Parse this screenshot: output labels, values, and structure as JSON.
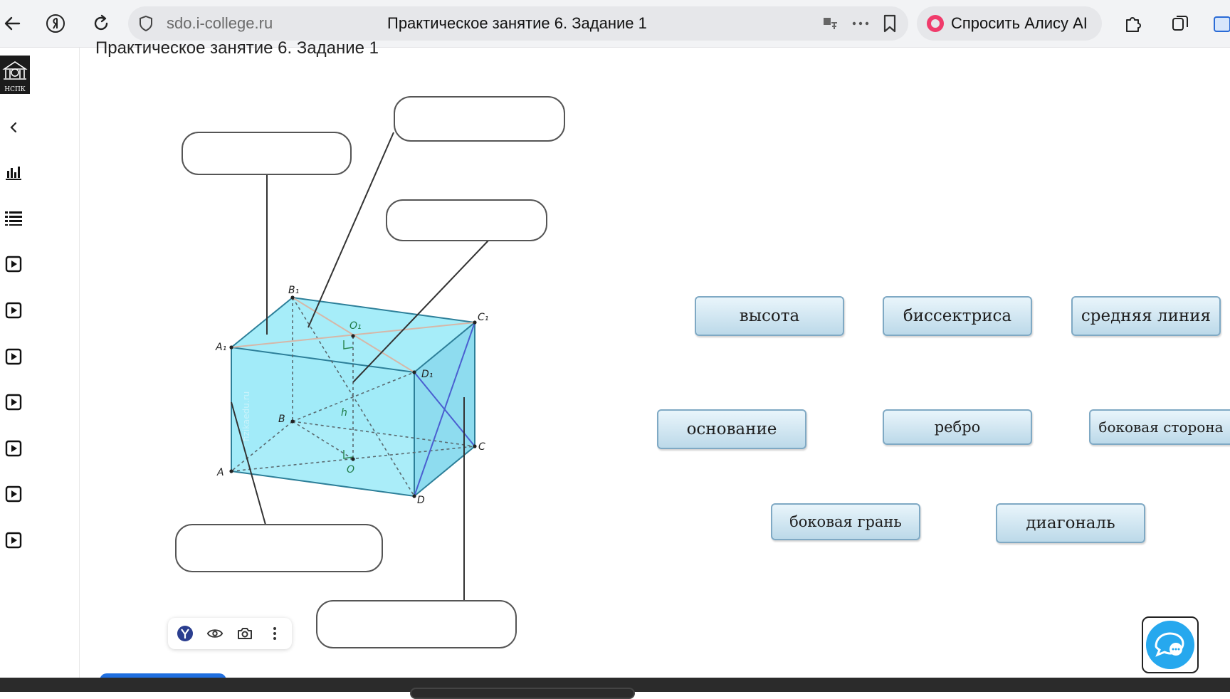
{
  "browser": {
    "url": "sdo.i-college.ru",
    "tab_title": "Практическое занятие 6. Задание 1",
    "alice_label": "Спросить Алису AI"
  },
  "sidebar": {
    "logo_text": "НСПК"
  },
  "page": {
    "heading": "Практическое занятие 6. Задание 1"
  },
  "diagram": {
    "vertex_labels": [
      "B₁",
      "C₁",
      "A₁",
      "D₁",
      "O₁",
      "B",
      "C",
      "A",
      "D",
      "O",
      "h"
    ],
    "watermark": "fizikaedu.ru"
  },
  "words": [
    "высота",
    "биссектриса",
    "средняя линия",
    "основание",
    "ребро",
    "боковая сторона",
    "боковая грань",
    "диагональ"
  ],
  "colors": {
    "prism_fill": "#9fe9f8",
    "prism_edge": "#2d8caa",
    "accent_chat": "#26a8ee"
  }
}
